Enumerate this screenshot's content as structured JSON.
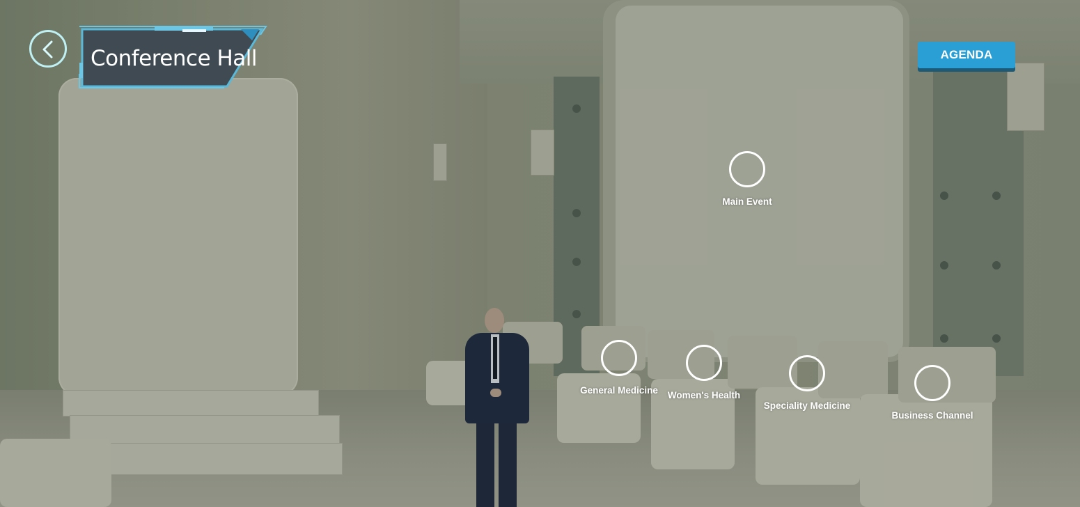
{
  "header": {
    "title": "Conference Hall",
    "back_icon": "chevron-left-icon"
  },
  "toolbar": {
    "agenda_label": "AGENDA"
  },
  "hotspots": [
    {
      "label": "Main Event"
    },
    {
      "label": "General Medicine"
    },
    {
      "label": "Women's Health"
    },
    {
      "label": "Speciality Medicine"
    },
    {
      "label": "Business Channel"
    }
  ],
  "colors": {
    "accent": "#2a9fd6",
    "plate": "#3f4a52",
    "plate_border": "#5ab8d8",
    "ring": "#ffffff"
  }
}
